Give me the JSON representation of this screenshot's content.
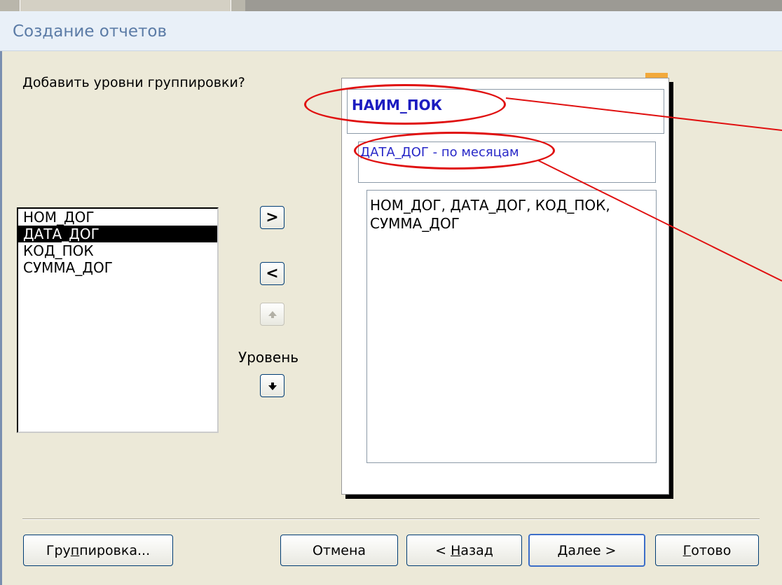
{
  "window": {
    "title": "Создание отчетов"
  },
  "prompt": "Добавить уровни группировки?",
  "fields": [
    {
      "label": "НОМ_ДОГ",
      "selected": false
    },
    {
      "label": "ДАТА_ДОГ",
      "selected": true
    },
    {
      "label": "КОД_ПОК",
      "selected": false
    },
    {
      "label": "СУММА_ДОГ",
      "selected": false
    }
  ],
  "controls": {
    "add_label": ">",
    "remove_label": "<",
    "up_icon": "arrow-up-icon",
    "down_icon": "arrow-down-icon",
    "level_label": "Уровень"
  },
  "preview": {
    "level1": "НАИМ_ПОК",
    "level2": "ДАТА_ДОГ - по месяцам",
    "detail": "НОМ_ДОГ, ДАТА_ДОГ, КОД_ПОК, СУММА_ДОГ"
  },
  "buttons": {
    "grouping": {
      "pre": "Гру",
      "u": "п",
      "post": "пировка..."
    },
    "cancel": {
      "pre": "Отмена",
      "u": "",
      "post": ""
    },
    "back": {
      "pre": "< ",
      "u": "Н",
      "post": "азад"
    },
    "next": {
      "pre": "",
      "u": "Д",
      "post": "алее >"
    },
    "finish": {
      "pre": "",
      "u": "Г",
      "post": "отово"
    }
  },
  "colors": {
    "highlight_ring": "#e01010",
    "level_text": "#1c1cc0",
    "title_text": "#5b7ba6"
  }
}
